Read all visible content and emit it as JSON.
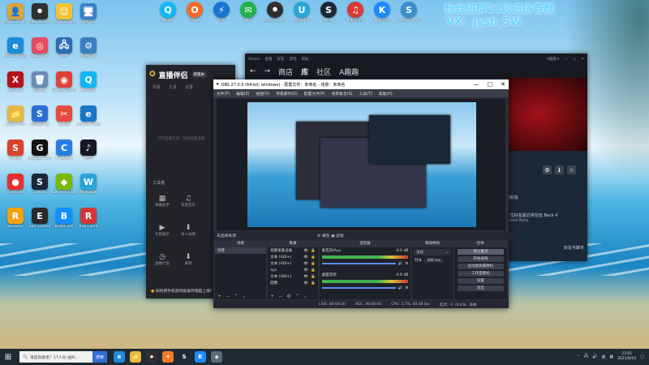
{
  "watermark": {
    "line1": "粉丝进群21级进房管群",
    "line2": "VX：jysb_SW"
  },
  "desktop_icons": [
    {
      "label": "Administrat...",
      "glyph": "👤",
      "color": "#d9a441"
    },
    {
      "label": "OBS\nStudio",
      "glyph": "⏺",
      "color": "#302e31"
    },
    {
      "label": "VeryCapture",
      "glyph": "😊",
      "color": "#f1c232"
    },
    {
      "label": "此电脑",
      "glyph": "🖥",
      "color": "#3b7fc4"
    },
    {
      "label": "Microsoft Edge",
      "glyph": "e",
      "color": "#1f8bd9"
    },
    {
      "label": "WeGame",
      "glyph": "◎",
      "color": "#e84a5f"
    },
    {
      "label": "网络",
      "glyph": "🖧",
      "color": "#2d6fb3"
    },
    {
      "label": "控制面板",
      "glyph": "⚙",
      "color": "#3a7fc1"
    },
    {
      "label": "XBLACK",
      "glyph": "X",
      "color": "#b5121b"
    },
    {
      "label": "回收站",
      "glyph": "🗑",
      "color": "#6a8db5"
    },
    {
      "label": "Google Chrome",
      "glyph": "◉",
      "color": "#db4437"
    },
    {
      "label": "腾讯QQ",
      "glyph": "Q",
      "color": "#12b7f5"
    },
    {
      "label": "新建文件夹",
      "glyph": "📁",
      "color": "#e8b840"
    },
    {
      "label": "搜狗输入法",
      "glyph": "S",
      "color": "#2b6fd6"
    },
    {
      "label": "快剪辑",
      "glyph": "✂",
      "color": "#e64c3c"
    },
    {
      "label": "Internet Explorer",
      "glyph": "e",
      "color": "#1b75c8"
    },
    {
      "label": "Snagit",
      "glyph": "S",
      "color": "#d8442b"
    },
    {
      "label": "Logitech G HUB",
      "glyph": "G",
      "color": "#111111"
    },
    {
      "label": "CCleaner",
      "glyph": "C",
      "color": "#2a7de1"
    },
    {
      "label": "抖音",
      "glyph": "♪",
      "color": "#161823"
    },
    {
      "label": "Bandicam",
      "glyph": "●",
      "color": "#e62e2e"
    },
    {
      "label": "Steam",
      "glyph": "S",
      "color": "#1b2838"
    },
    {
      "label": "GeForce Experience",
      "glyph": "◆",
      "color": "#76b900"
    },
    {
      "label": "Wallpaper",
      "glyph": "W",
      "color": "#29a3d9"
    },
    {
      "label": "Rockstar",
      "glyph": "R",
      "color": "#f2a10f"
    },
    {
      "label": "Epic Games",
      "glyph": "E",
      "color": "#2a2a2a"
    },
    {
      "label": "Battle.net",
      "glyph": "B",
      "color": "#148eff"
    },
    {
      "label": "Riot Client",
      "glyph": "R",
      "color": "#d13639"
    }
  ],
  "top_icons": [
    {
      "label": "腾讯QQ",
      "glyph": "Q",
      "color": "#12b7f5"
    },
    {
      "label": "Origin",
      "glyph": "O",
      "color": "#f56c2d"
    },
    {
      "label": "迅雷",
      "glyph": "⚡",
      "color": "#1a76d2"
    },
    {
      "label": "微信",
      "glyph": "✉",
      "color": "#22b14c"
    },
    {
      "label": "OBS Studio",
      "glyph": "⏺",
      "color": "#302e31"
    },
    {
      "label": "UU加速器",
      "glyph": "U",
      "color": "#27a8d8"
    },
    {
      "label": "Steam",
      "glyph": "S",
      "color": "#1b2838"
    },
    {
      "label": "网易云音乐",
      "glyph": "♫",
      "color": "#d93a33"
    },
    {
      "label": "酷狗音乐",
      "glyph": "K",
      "color": "#1a8cff"
    },
    {
      "label": "Steam 加速",
      "glyph": "S",
      "color": "#3d8ecf"
    }
  ],
  "steam": {
    "menu": [
      "Steam",
      "查看",
      "好友",
      "游戏",
      "帮助"
    ],
    "nav": [
      "商店",
      "库",
      "社区",
      "A趣趣"
    ],
    "user": "A趣趣 ▾",
    "side_lines": [
      "的好友",
      "1 位好友最近常在玩 Back 4",
      "Blood Beta"
    ],
    "footer": "好友与聊天"
  },
  "live": {
    "title": "直播伴侣",
    "badge": "新版本",
    "tabs": [
      "场景",
      "工具",
      "设置"
    ],
    "preview_hint": "打开直播工具，快速设置直播",
    "tools_title": "工具箱",
    "tools": [
      {
        "icon": "▦",
        "label": "弹幕助手"
      },
      {
        "icon": "♫",
        "label": "背景音乐"
      },
      {
        "icon": "▶",
        "label": "礼物展示"
      },
      {
        "icon": "⬇",
        "label": "本人录像"
      },
      {
        "icon": "◷",
        "label": "直播计划"
      },
      {
        "icon": "⬇",
        "label": "录制"
      }
    ],
    "bottom_note": "如何把手机游戏投屏到电脑上播？"
  },
  "obs": {
    "title": "OBS 27.0.0 (64-bit, windows) - 配置文件：未命名 - 场景：未命名",
    "menu": [
      "文件(F)",
      "编辑(E)",
      "视图(V)",
      "停靠部件(D)",
      "配置文件(P)",
      "场景集合(S)",
      "工具(T)",
      "帮助(H)"
    ],
    "scene_bar": "未选择来源",
    "scene_bar_right": "⚙ 属性  ▣ 滤镜",
    "docks": {
      "scenes": {
        "title": "场景",
        "items": [
          "场景"
        ]
      },
      "sources": {
        "title": "来源",
        "items": [
          "视频采集设备",
          "文本 (GDI+)",
          "文本 (GDI+)",
          "Sys",
          "文本 (GDI+)",
          "图像"
        ]
      },
      "mixer": {
        "title": "混音器",
        "tracks": [
          {
            "name": "麦克风/Aux",
            "db": "-0.0 dB"
          },
          {
            "name": "桌面音频",
            "db": "-0.0 dB"
          }
        ]
      },
      "transitions": {
        "title": "转场特效",
        "type": "淡化",
        "duration_label": "时长",
        "duration": "300 ms"
      },
      "controls": {
        "title": "控件",
        "buttons": [
          "停止推流",
          "开始录制",
          "启动虚拟摄像机",
          "工作室模式",
          "设置",
          "退出"
        ]
      }
    },
    "status": [
      "LIVE: 00:00:00",
      "REC: 00:00:00",
      "CPU: 3.7%, 60.00 fps",
      "延迟：0（0.0%）丢帧"
    ]
  },
  "taskbar": {
    "search_placeholder": "谁是隐藏者？17人局 抽到...",
    "search_button": "搜索",
    "apps": [
      {
        "glyph": "e",
        "color": "#1f8bd9"
      },
      {
        "glyph": "📁",
        "color": "#e8b840"
      },
      {
        "glyph": "⏺",
        "color": "#302e31"
      },
      {
        "glyph": "✦",
        "color": "#f07a22"
      },
      {
        "glyph": "S",
        "color": "#1b2838"
      },
      {
        "glyph": "K",
        "color": "#1a8cff"
      },
      {
        "glyph": "◈",
        "color": "#5a6b7a"
      }
    ],
    "lang": "英",
    "time": "23:01",
    "date": "2021/8/14"
  }
}
